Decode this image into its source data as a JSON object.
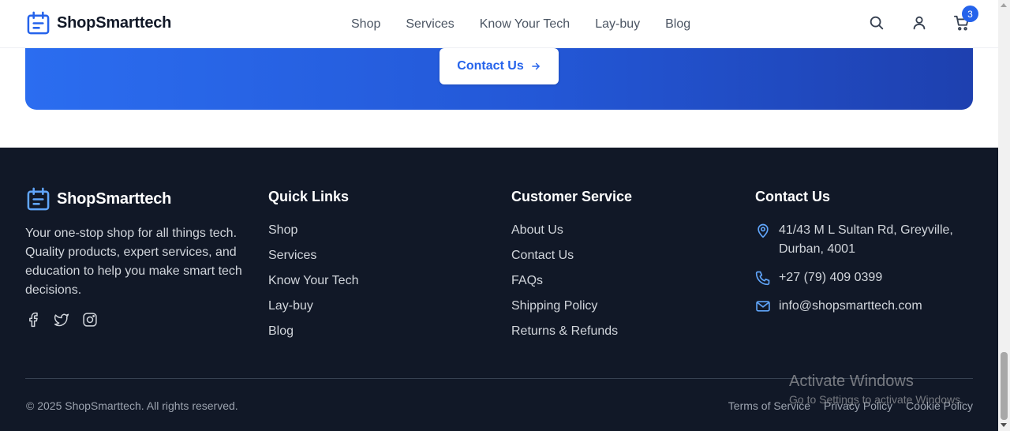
{
  "header": {
    "brand": "ShopSmarttech",
    "nav": [
      "Shop",
      "Services",
      "Know Your Tech",
      "Lay-buy",
      "Blog"
    ],
    "icons": [
      "search-icon",
      "user-icon",
      "cart-icon"
    ],
    "cart_count": "3"
  },
  "cta": {
    "button_label": "Contact Us"
  },
  "footer": {
    "brand": "ShopSmarttech",
    "about": "Your one-stop shop for all things tech. Quality products, expert services, and education to help you make smart tech decisions.",
    "social_icons": [
      "facebook-icon",
      "twitter-icon",
      "instagram-icon"
    ],
    "quick_links": {
      "title": "Quick Links",
      "items": [
        "Shop",
        "Services",
        "Know Your Tech",
        "Lay-buy",
        "Blog"
      ]
    },
    "customer_service": {
      "title": "Customer Service",
      "items": [
        "About Us",
        "Contact Us",
        "FAQs",
        "Shipping Policy",
        "Returns & Refunds"
      ]
    },
    "contact": {
      "title": "Contact Us",
      "address_line1": "41/43 M L Sultan Rd, Greyville,",
      "address_line2": "Durban, 4001",
      "phone": "+27 (79) 409 0399",
      "email": "info@shopsmarttech.com"
    },
    "copyright": "© 2025 ShopSmarttech. All rights reserved.",
    "legal": [
      "Terms of Service",
      "Privacy Policy",
      "Cookie Policy"
    ]
  },
  "watermark": {
    "line1": "Activate Windows",
    "line2": "Go to Settings to activate Windows."
  },
  "colors": {
    "accent": "#2563eb",
    "footer_bg": "#111827",
    "cta_gradient_start": "#2b6df0",
    "cta_gradient_end": "#1e40af"
  }
}
